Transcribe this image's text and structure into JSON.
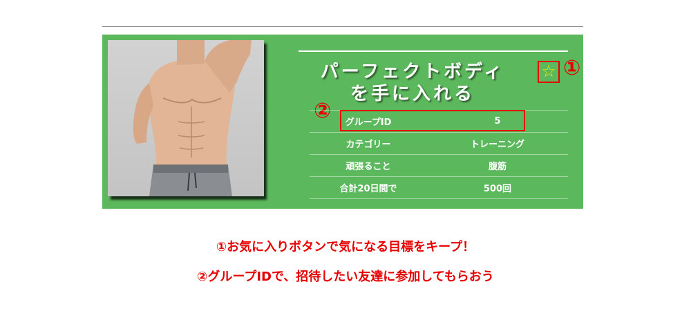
{
  "card": {
    "title_line1": "パーフェクトボディ",
    "title_line2": "を手に入れる",
    "favorite_icon": "☆",
    "favorite_icon_name": "star-outline-icon",
    "callout1": "①",
    "callout2": "②",
    "rows": [
      {
        "label": "グループID",
        "value": "5"
      },
      {
        "label": "カテゴリー",
        "value": "トレーニング"
      },
      {
        "label": "頑張ること",
        "value": "腹筋"
      },
      {
        "label": "合計20日間で",
        "value": "500回"
      }
    ]
  },
  "notes": {
    "line1": "①お気に入りボタンで気になる目標をキープ！",
    "line2": "②グループIDで、招待したい友達に参加してもらおう"
  },
  "colors": {
    "card_green": "#5cb85c",
    "annotation_red": "#e60000",
    "star_yellow": "#f2e200"
  }
}
